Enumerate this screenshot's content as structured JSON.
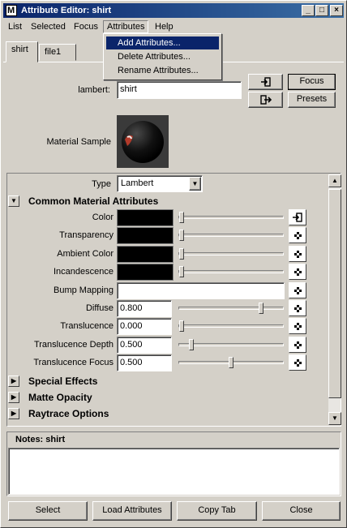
{
  "window": {
    "title": "Attribute Editor: shirt"
  },
  "menubar": {
    "items": [
      "List",
      "Selected",
      "Focus",
      "Attributes",
      "Help"
    ],
    "active_index": 3
  },
  "attributes_menu": {
    "items": [
      "Add Attributes...",
      "Delete Attributes...",
      "Rename Attributes..."
    ],
    "highlighted_index": 0
  },
  "tabs": [
    "shirt",
    "file1"
  ],
  "selected_tab": "shirt",
  "node": {
    "type_label": "lambert:",
    "name_value": "shirt",
    "focus_button": "Focus",
    "presets_button": "Presets",
    "material_sample_label": "Material Sample"
  },
  "type_row": {
    "label": "Type",
    "value": "Lambert"
  },
  "sections": {
    "common": "Common Material Attributes",
    "special": "Special Effects",
    "matte": "Matte Opacity",
    "raytrace": "Raytrace Options"
  },
  "attributes": [
    {
      "label": "Color",
      "kind": "swatch",
      "slider": 0.0,
      "map": "input"
    },
    {
      "label": "Transparency",
      "kind": "swatch",
      "slider": 0.0,
      "map": "checker"
    },
    {
      "label": "Ambient Color",
      "kind": "swatch",
      "slider": 0.0,
      "map": "checker"
    },
    {
      "label": "Incandescence",
      "kind": "swatch",
      "slider": 0.0,
      "map": "checker"
    },
    {
      "label": "Bump Mapping",
      "kind": "field",
      "value": "",
      "map": "checker"
    },
    {
      "label": "Diffuse",
      "kind": "number",
      "value": "0.800",
      "slider": 0.8,
      "map": "checker"
    },
    {
      "label": "Translucence",
      "kind": "number",
      "value": "0.000",
      "slider": 0.0,
      "map": "checker"
    },
    {
      "label": "Translucence Depth",
      "kind": "number",
      "value": "0.500",
      "slider": 0.1,
      "map": "checker"
    },
    {
      "label": "Translucence Focus",
      "kind": "number",
      "value": "0.500",
      "slider": 0.5,
      "map": "checker"
    }
  ],
  "notes": {
    "label": "Notes:  shirt",
    "value": ""
  },
  "bottom_buttons": {
    "select": "Select",
    "load": "Load Attributes",
    "copy": "Copy Tab",
    "close": "Close"
  },
  "colors": {
    "title_start": "#0a246a",
    "title_end": "#3a6ea5",
    "menu_highlight": "#0a246a",
    "face": "#d4d0c8"
  }
}
